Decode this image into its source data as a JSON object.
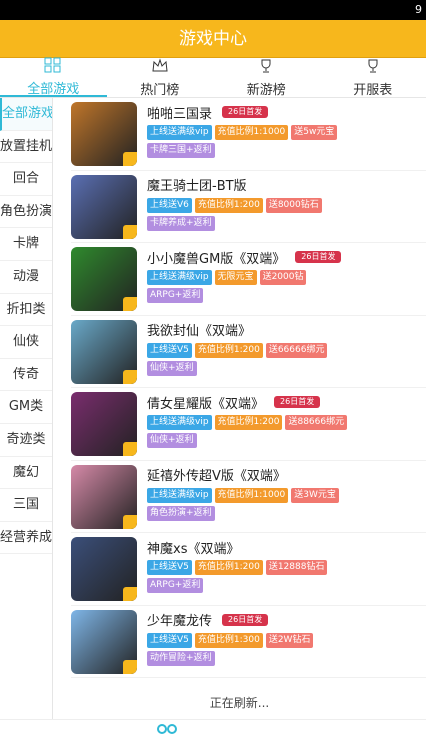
{
  "status": {
    "time": "9"
  },
  "header": {
    "title": "游戏中心"
  },
  "tabs": [
    {
      "label": "全部游戏",
      "icon": "grid-icon",
      "active": true
    },
    {
      "label": "热门榜",
      "icon": "crown-icon"
    },
    {
      "label": "新游榜",
      "icon": "trophy-icon"
    },
    {
      "label": "开服表",
      "icon": "trophy-icon"
    }
  ],
  "sidebar": {
    "items": [
      "全部游戏",
      "放置挂机",
      "回合",
      "角色扮演",
      "卡牌",
      "动漫",
      "折扣类",
      "仙侠",
      "传奇",
      "GM类",
      "奇迹类",
      "魔幻",
      "三国",
      "经营养成"
    ]
  },
  "games": [
    {
      "name": "啪啪三国录",
      "badge": "26日首发",
      "tags": [
        {
          "t": "上线送满级vip",
          "c": "blue"
        },
        {
          "t": "充值比例1:1000",
          "c": "orange"
        },
        {
          "t": "送5w元宝",
          "c": "red"
        }
      ],
      "tags2": [
        {
          "t": "卡牌三国+返利",
          "c": "purple"
        }
      ],
      "color": "#c0762a"
    },
    {
      "name": "魔王骑士团-BT版",
      "badge": "",
      "tags": [
        {
          "t": "上线送V6",
          "c": "blue"
        },
        {
          "t": "充值比例1:200",
          "c": "orange"
        },
        {
          "t": "送8000钻石",
          "c": "red"
        }
      ],
      "tags2": [
        {
          "t": "卡牌养成+返利",
          "c": "purple"
        }
      ],
      "color": "#5a6fb3"
    },
    {
      "name": "小小魔兽GM版《双端》",
      "badge": "26日首发",
      "tags": [
        {
          "t": "上线送满级vip",
          "c": "blue"
        },
        {
          "t": "无限元宝",
          "c": "orange"
        },
        {
          "t": "送2000钻",
          "c": "red"
        }
      ],
      "tags2": [
        {
          "t": "ARPG+返利",
          "c": "purple"
        }
      ],
      "color": "#2f8a2d"
    },
    {
      "name": "我欲封仙《双端》",
      "badge": "",
      "tags": [
        {
          "t": "上线送V5",
          "c": "blue"
        },
        {
          "t": "充值比例1:200",
          "c": "orange"
        },
        {
          "t": "送66666绑元",
          "c": "red"
        }
      ],
      "tags2": [
        {
          "t": "仙侠+返利",
          "c": "purple"
        }
      ],
      "color": "#6aa9c9"
    },
    {
      "name": "倩女星耀版《双端》",
      "badge": "26日首发",
      "tags": [
        {
          "t": "上线送满级vip",
          "c": "blue"
        },
        {
          "t": "充值比例1:200",
          "c": "orange"
        },
        {
          "t": "送88666绑元",
          "c": "red"
        }
      ],
      "tags2": [
        {
          "t": "仙侠+返利",
          "c": "purple"
        }
      ],
      "color": "#7a2d6e"
    },
    {
      "name": "延禧外传超V版《双端》",
      "badge": "",
      "tags": [
        {
          "t": "上线送满级vip",
          "c": "blue"
        },
        {
          "t": "充值比例1:1000",
          "c": "orange"
        },
        {
          "t": "送3W元宝",
          "c": "red"
        }
      ],
      "tags2": [
        {
          "t": "角色扮演+返利",
          "c": "purple"
        }
      ],
      "color": "#d68aa8"
    },
    {
      "name": "神魔xs《双端》",
      "badge": "",
      "tags": [
        {
          "t": "上线送V5",
          "c": "blue"
        },
        {
          "t": "充值比例1:200",
          "c": "orange"
        },
        {
          "t": "送12888钻石",
          "c": "red"
        }
      ],
      "tags2": [
        {
          "t": "ARPG+返利",
          "c": "purple"
        }
      ],
      "color": "#3b4f7a"
    },
    {
      "name": "少年魔龙传",
      "badge": "26日首发",
      "tags": [
        {
          "t": "上线送V5",
          "c": "blue"
        },
        {
          "t": "充值比例1:300",
          "c": "orange"
        },
        {
          "t": "送2W钻石",
          "c": "red"
        }
      ],
      "tags2": [
        {
          "t": "动作冒险+返利",
          "c": "purple"
        }
      ],
      "color": "#7fb6e8"
    }
  ],
  "footer": {
    "refresh": "正在刷新..."
  }
}
